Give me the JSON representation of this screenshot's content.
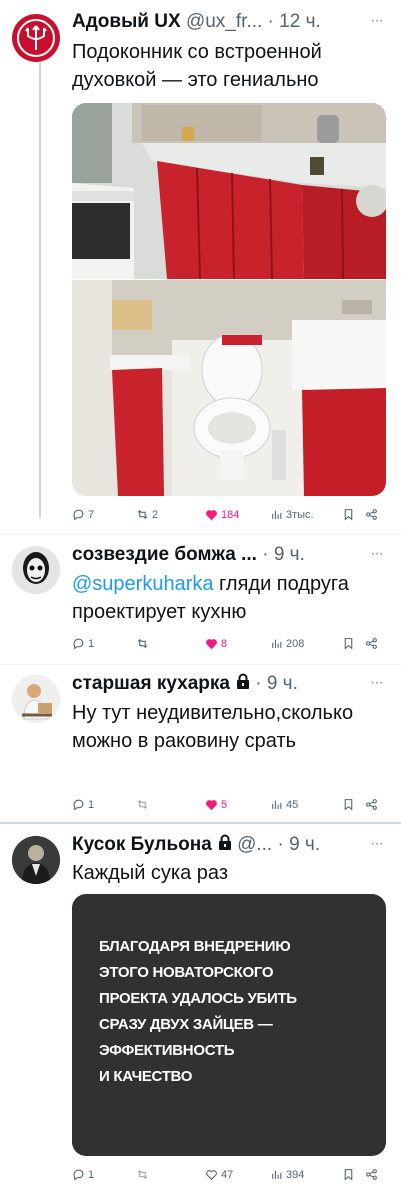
{
  "tweets": [
    {
      "name": "Адовый UX",
      "handle": "@ux_fr...",
      "time": "· 12 ч.",
      "text": "Подоконник со встроенной духовкой — это гениально",
      "stats": {
        "replies": "7",
        "retweets": "2",
        "likes": "184",
        "views": "3тыс."
      }
    },
    {
      "name": "созвездие бомжа ...",
      "time": "· 9 ч.",
      "mention": "@superkuharka",
      "text": " гляди подруга проектирует кухню",
      "stats": {
        "replies": "1",
        "retweets": "",
        "likes": "8",
        "views": "208"
      }
    },
    {
      "name": "старшая кухарка",
      "time": "· 9 ч.",
      "text": "Ну тут неудивительно,сколько можно в раковину срать",
      "stats": {
        "replies": "1",
        "retweets": "",
        "likes": "5",
        "views": "45"
      }
    },
    {
      "name": "Кусок Бульона",
      "handle": "@...",
      "time": "· 9 ч.",
      "text": "Каждый сука раз",
      "quote_image_text": "БЛАГОДАРЯ ВНЕДРЕНИЮ\nЭТОГО НОВАТОРСКОГО\nПРОЕКТА УДАЛОСЬ УБИТЬ\nСРАЗУ ДВУХ ЗАЙЦЕВ —\nЭФФЕКТИВНОСТЬ\nИ КАЧЕСТВО",
      "stats": {
        "replies": "1",
        "retweets": "",
        "likes": "47",
        "views": "394"
      }
    }
  ],
  "icons": {
    "reply": "reply-icon",
    "retweet": "retweet-icon",
    "like": "heart-icon",
    "views": "views-icon",
    "bookmark": "bookmark-icon",
    "share": "share-icon",
    "more": "more-icon",
    "lock": "lock-icon"
  },
  "colors": {
    "like": "#f91880",
    "link": "#1d9bf0",
    "secondary": "#536471",
    "thread": "#cfd9de"
  }
}
